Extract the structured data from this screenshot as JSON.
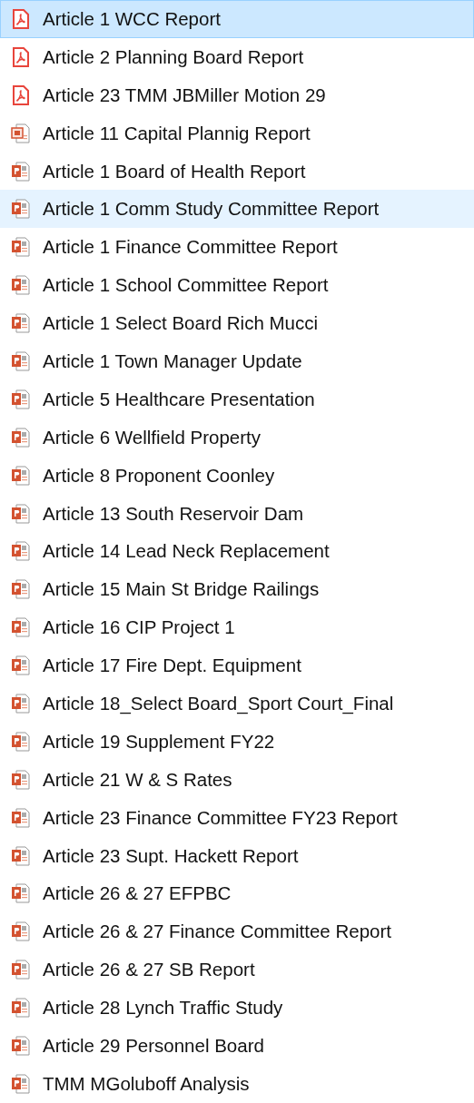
{
  "files": [
    {
      "name": "Article 1 WCC Report",
      "kind": "pdf",
      "selected": true,
      "hovered": false
    },
    {
      "name": "Article 2 Planning Board Report",
      "kind": "pdf",
      "selected": false,
      "hovered": false
    },
    {
      "name": "Article 23 TMM JBMiller Motion 29",
      "kind": "pdf",
      "selected": false,
      "hovered": false
    },
    {
      "name": "Article 11 Capital Plannig Report",
      "kind": "slideshow",
      "selected": false,
      "hovered": false
    },
    {
      "name": "Article 1 Board of Health Report",
      "kind": "pptx",
      "selected": false,
      "hovered": false
    },
    {
      "name": "Article 1 Comm Study Committee Report",
      "kind": "pptx",
      "selected": false,
      "hovered": true
    },
    {
      "name": "Article 1 Finance Committee Report",
      "kind": "pptx",
      "selected": false,
      "hovered": false
    },
    {
      "name": "Article 1 School Committee Report",
      "kind": "pptx",
      "selected": false,
      "hovered": false
    },
    {
      "name": "Article 1 Select Board Rich Mucci",
      "kind": "pptx",
      "selected": false,
      "hovered": false
    },
    {
      "name": "Article 1 Town Manager Update",
      "kind": "pptx",
      "selected": false,
      "hovered": false
    },
    {
      "name": "Article 5 Healthcare Presentation",
      "kind": "pptx",
      "selected": false,
      "hovered": false
    },
    {
      "name": "Article 6 Wellfield Property",
      "kind": "pptx",
      "selected": false,
      "hovered": false
    },
    {
      "name": "Article 8 Proponent Coonley",
      "kind": "pptx",
      "selected": false,
      "hovered": false
    },
    {
      "name": "Article 13 South Reservoir Dam",
      "kind": "pptx",
      "selected": false,
      "hovered": false
    },
    {
      "name": "Article 14 Lead Neck Replacement",
      "kind": "pptx",
      "selected": false,
      "hovered": false
    },
    {
      "name": "Article 15 Main St Bridge Railings",
      "kind": "pptx",
      "selected": false,
      "hovered": false
    },
    {
      "name": "Article 16 CIP Project 1",
      "kind": "pptx",
      "selected": false,
      "hovered": false
    },
    {
      "name": "Article 17 Fire Dept. Equipment",
      "kind": "pptx",
      "selected": false,
      "hovered": false
    },
    {
      "name": "Article 18_Select Board_Sport Court_Final",
      "kind": "pptx",
      "selected": false,
      "hovered": false
    },
    {
      "name": "Article 19 Supplement FY22",
      "kind": "pptx",
      "selected": false,
      "hovered": false
    },
    {
      "name": "Article 21 W & S Rates",
      "kind": "pptx",
      "selected": false,
      "hovered": false
    },
    {
      "name": "Article 23 Finance Committee FY23 Report",
      "kind": "pptx",
      "selected": false,
      "hovered": false
    },
    {
      "name": "Article 23 Supt. Hackett Report",
      "kind": "pptx",
      "selected": false,
      "hovered": false
    },
    {
      "name": "Article 26 & 27 EFPBC",
      "kind": "pptx",
      "selected": false,
      "hovered": false
    },
    {
      "name": "Article 26 & 27 Finance Committee Report",
      "kind": "pptx",
      "selected": false,
      "hovered": false
    },
    {
      "name": "Article 26 & 27 SB Report",
      "kind": "pptx",
      "selected": false,
      "hovered": false
    },
    {
      "name": "Article 28 Lynch Traffic Study",
      "kind": "pptx",
      "selected": false,
      "hovered": false
    },
    {
      "name": "Article 29 Personnel Board",
      "kind": "pptx",
      "selected": false,
      "hovered": false
    },
    {
      "name": "TMM MGoluboff Analysis",
      "kind": "pptx",
      "selected": false,
      "hovered": false
    }
  ]
}
